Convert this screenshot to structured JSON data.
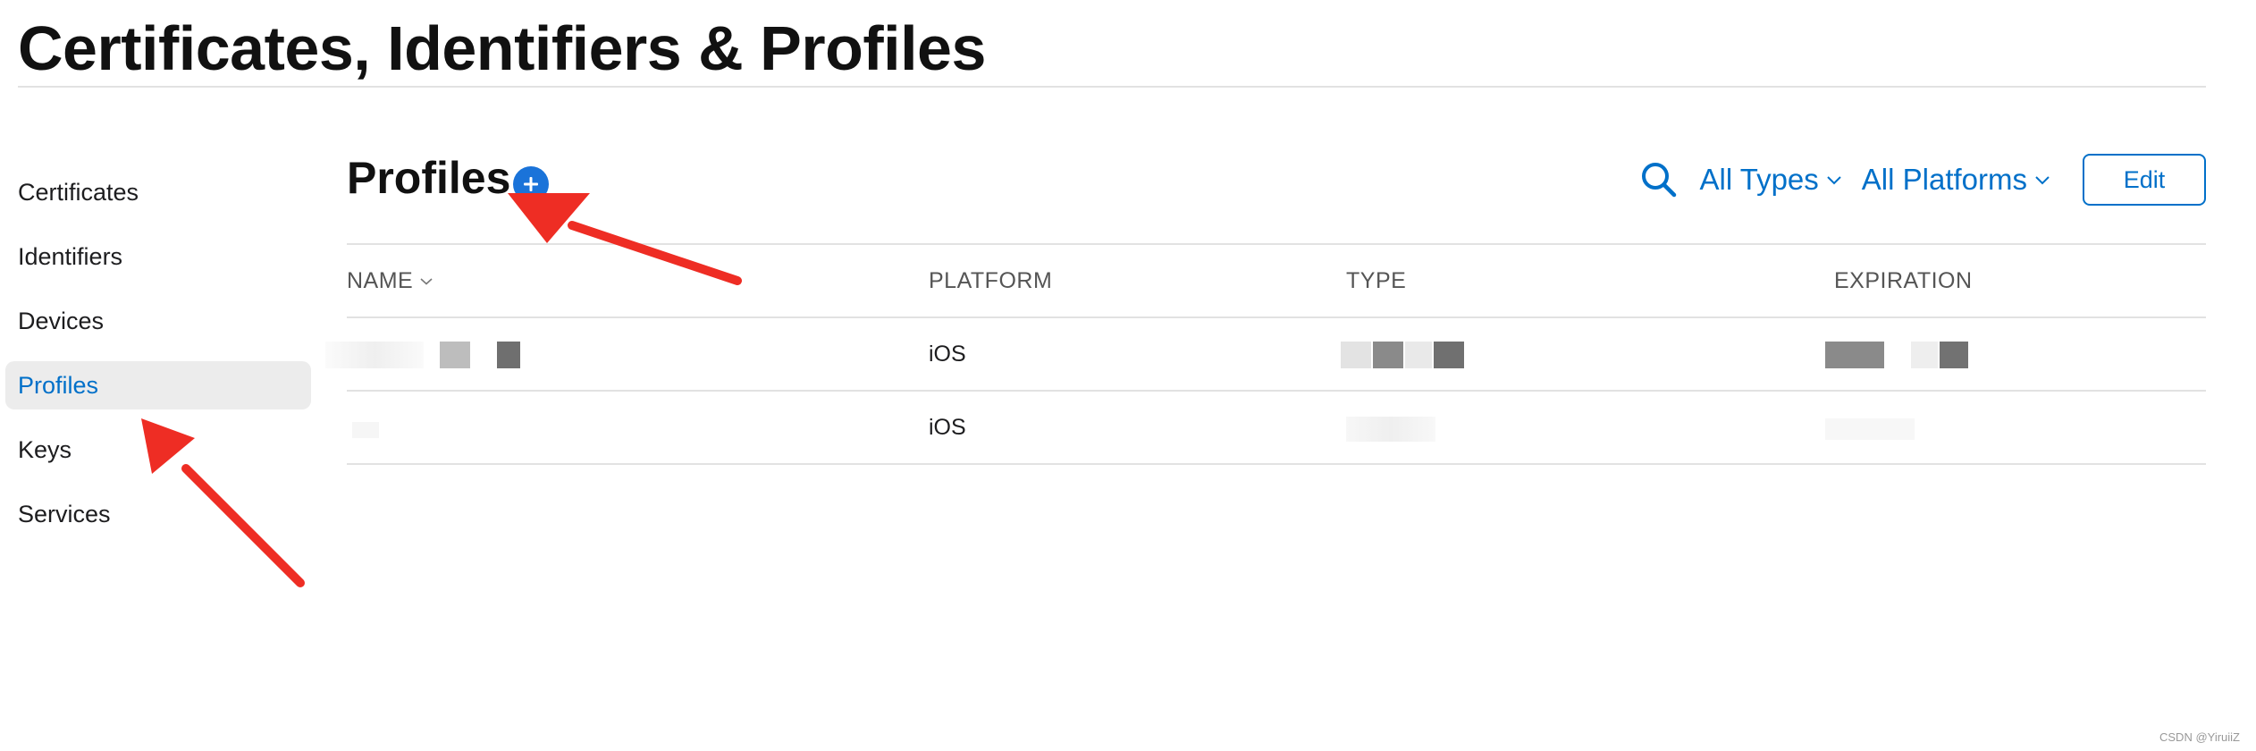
{
  "page": {
    "title": "Certificates, Identifiers & Profiles"
  },
  "sidebar": {
    "items": [
      {
        "label": "Certificates",
        "active": false
      },
      {
        "label": "Identifiers",
        "active": false
      },
      {
        "label": "Devices",
        "active": false
      },
      {
        "label": "Profiles",
        "active": true
      },
      {
        "label": "Keys",
        "active": false
      },
      {
        "label": "Services",
        "active": false
      }
    ]
  },
  "main": {
    "heading": "Profiles",
    "add_icon": "plus-circle-icon",
    "search_icon": "search-icon",
    "filters": [
      {
        "label": "All Types"
      },
      {
        "label": "All Platforms"
      }
    ],
    "edit_label": "Edit"
  },
  "table": {
    "columns": [
      "NAME",
      "PLATFORM",
      "TYPE",
      "EXPIRATION"
    ],
    "rows": [
      {
        "name": "",
        "platform": "iOS",
        "type": "",
        "expiration": ""
      },
      {
        "name": "",
        "platform": "iOS",
        "type": "",
        "expiration": ""
      }
    ]
  },
  "watermark": "CSDN @YiruiiZ",
  "colors": {
    "accent": "#0070c9",
    "add_button": "#1a73d9",
    "active_bg": "#ececec",
    "annotation_arrow": "#ee2d24"
  }
}
